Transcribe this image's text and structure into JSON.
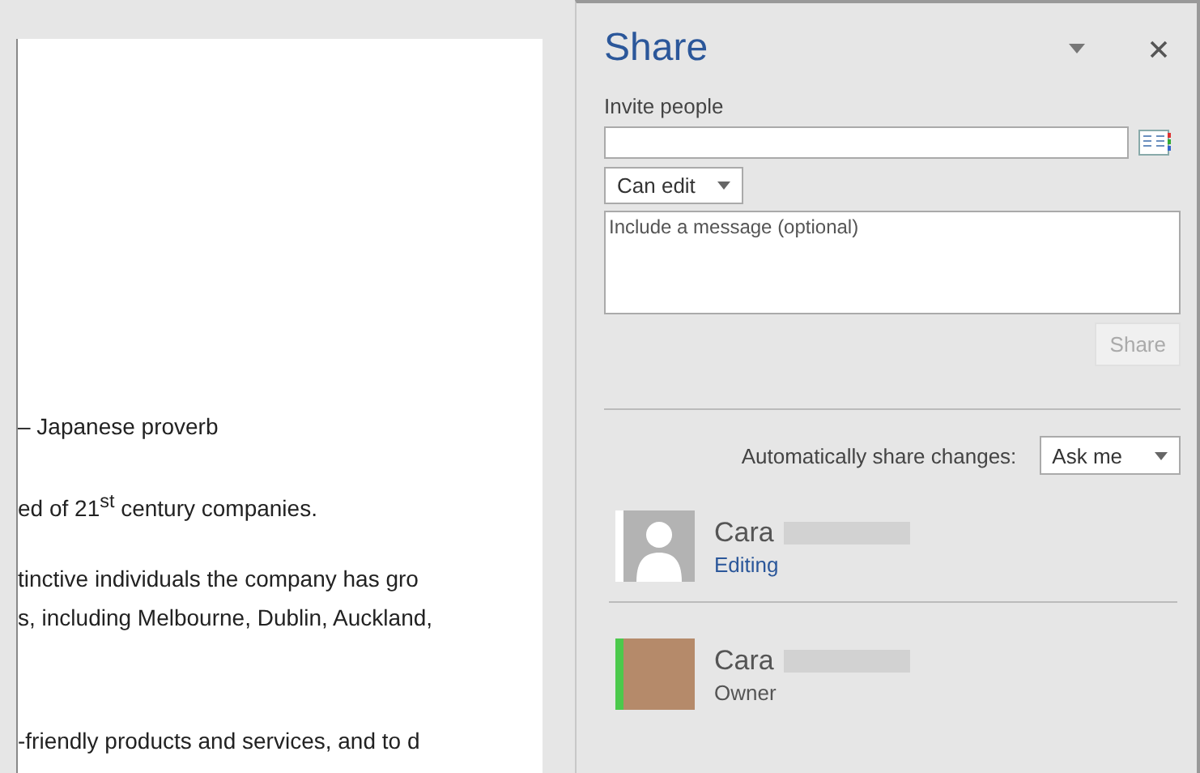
{
  "document": {
    "paragraphs": [
      {
        "lines": [
          "– Japanese proverb"
        ],
        "blank_line_before": false
      },
      {
        "lines": [
          "ed of 21$^{st}$ century companies."
        ],
        "blank_line_before": false
      },
      {
        "lines": [
          "tinctive individuals the company has gro",
          "s, including Melbourne, Dublin, Auckland,"
        ],
        "blank_line_before": false
      },
      {
        "lines": [
          "-friendly products and services, and to d"
        ],
        "blank_line_before": true
      }
    ]
  },
  "share_pane": {
    "title": "Share",
    "invite_label": "Invite people",
    "permission": "Can edit",
    "message_placeholder": "Include a message (optional)",
    "share_button": {
      "label": "Share",
      "disabled": true
    },
    "auto_share_label": "Automatically share changes:",
    "auto_share_value": "Ask me",
    "people": [
      {
        "name": "Cara",
        "role": "Editing",
        "role_link": true,
        "kind": "silhouette",
        "color": "#ffffff"
      },
      {
        "name": "Cara",
        "role": "Owner",
        "role_link": false,
        "kind": "photo",
        "color": "#4cc94c"
      }
    ]
  }
}
